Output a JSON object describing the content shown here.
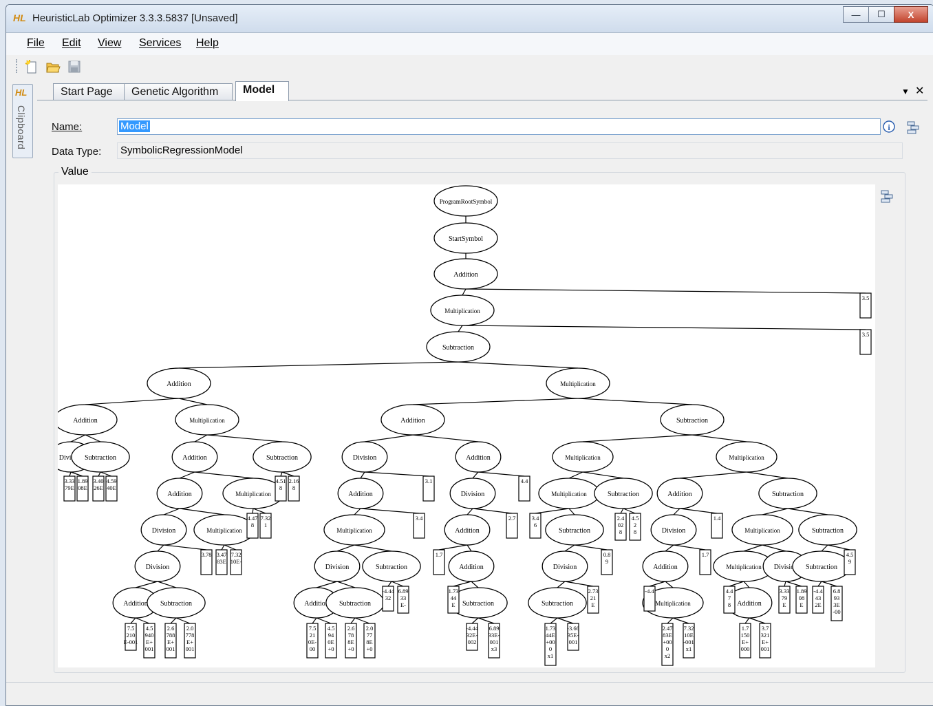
{
  "window": {
    "app_logo": "HL",
    "title": "HeuristicLab Optimizer 3.3.3.5837 [Unsaved]",
    "controls": {
      "minimize": "—",
      "maximize": "☐",
      "close": "X"
    }
  },
  "menu": {
    "items": [
      {
        "label": "File"
      },
      {
        "label": "Edit"
      },
      {
        "label": "View"
      },
      {
        "label": "Services"
      },
      {
        "label": "Help"
      }
    ]
  },
  "toolbar": {
    "icons": [
      "new-file-icon",
      "open-folder-icon",
      "save-icon"
    ]
  },
  "sidebar": {
    "logo": "HL",
    "label": "Clipboard"
  },
  "tabs": [
    {
      "label": "Start Page",
      "active": false
    },
    {
      "label": "Genetic Algorithm",
      "active": false
    },
    {
      "label": "Model",
      "active": true
    }
  ],
  "tab_controls": {
    "dropdown": "▼",
    "close": "✕"
  },
  "form": {
    "name_label": "Name:",
    "name_value": "Model",
    "datatype_label": "Data Type:",
    "datatype_value": "SymbolicRegressionModel",
    "value_label": "Value"
  },
  "tree": {
    "nodes": [
      {
        "id": "root",
        "label": "ProgramRootSymbol"
      },
      {
        "id": "start",
        "label": "StartSymbol",
        "parent": "root"
      },
      {
        "id": "a1",
        "label": "Addition",
        "parent": "start"
      },
      {
        "id": "m1",
        "label": "Multiplication",
        "parent": "a1"
      },
      {
        "id": "s1",
        "label": "Subtraction",
        "parent": "m1"
      },
      {
        "id": "A",
        "label": "Addition",
        "parent": "s1"
      },
      {
        "id": "B",
        "label": "Multiplication",
        "parent": "s1"
      },
      {
        "id": "A1",
        "label": "Addition",
        "parent": "A"
      },
      {
        "id": "A2",
        "label": "Multiplication",
        "parent": "A"
      },
      {
        "id": "A1a",
        "label": "Division",
        "parent": "A1"
      },
      {
        "id": "A1b",
        "label": "Subtraction",
        "parent": "A1"
      },
      {
        "id": "A2a",
        "label": "Addition",
        "parent": "A2"
      },
      {
        "id": "A2b",
        "label": "Subtraction",
        "parent": "A2"
      },
      {
        "id": "A2a1",
        "label": "Addition",
        "parent": "A2a"
      },
      {
        "id": "A2a2",
        "label": "Multiplication",
        "parent": "A2a"
      },
      {
        "id": "A2a1a",
        "label": "Division",
        "parent": "A2a1"
      },
      {
        "id": "A2a1b",
        "label": "Multiplication",
        "parent": "A2a1"
      },
      {
        "id": "A2a1a1",
        "label": "Division",
        "parent": "A2a1a"
      },
      {
        "id": "A2a1a1a",
        "label": "Addition",
        "parent": "A2a1a1"
      },
      {
        "id": "A2a1a1b",
        "label": "Subtraction",
        "parent": "A2a1a1"
      },
      {
        "id": "B1",
        "label": "Addition",
        "parent": "B"
      },
      {
        "id": "B2",
        "label": "Subtraction",
        "parent": "B"
      },
      {
        "id": "B1a",
        "label": "Division",
        "parent": "B1"
      },
      {
        "id": "B1b",
        "label": "Addition",
        "parent": "B1"
      },
      {
        "id": "B1a1",
        "label": "Addition",
        "parent": "B1a"
      },
      {
        "id": "B1a1a",
        "label": "Multiplication",
        "parent": "B1a1"
      },
      {
        "id": "B1a1a1",
        "label": "Division",
        "parent": "B1a1a"
      },
      {
        "id": "B1a1a2",
        "label": "Subtraction",
        "parent": "B1a1a"
      },
      {
        "id": "B1a1a1a",
        "label": "Addition",
        "parent": "B1a1a1"
      },
      {
        "id": "B1a1a1b",
        "label": "Subtraction",
        "parent": "B1a1a1"
      },
      {
        "id": "B1b1",
        "label": "Division",
        "parent": "B1b"
      },
      {
        "id": "B1b1a",
        "label": "Addition",
        "parent": "B1b1"
      },
      {
        "id": "B1b1a1",
        "label": "Addition",
        "parent": "B1b1a"
      },
      {
        "id": "B1b1a1a",
        "label": "Subtraction",
        "parent": "B1b1a1"
      },
      {
        "id": "B2a",
        "label": "Multiplication",
        "parent": "B2"
      },
      {
        "id": "B2b",
        "label": "Multiplication",
        "parent": "B2"
      },
      {
        "id": "B2a1",
        "label": "Multiplication",
        "parent": "B2a"
      },
      {
        "id": "B2a2",
        "label": "Subtraction",
        "parent": "B2a"
      },
      {
        "id": "B2a1a",
        "label": "Subtraction",
        "parent": "B2a1"
      },
      {
        "id": "B2a1a1",
        "label": "Division",
        "parent": "B2a1a"
      },
      {
        "id": "B2a1a1a",
        "label": "Subtraction",
        "parent": "B2a1a1"
      },
      {
        "id": "B2b1",
        "label": "Addition",
        "parent": "B2b"
      },
      {
        "id": "B2b2",
        "label": "Subtraction",
        "parent": "B2b"
      },
      {
        "id": "B2b1a",
        "label": "Division",
        "parent": "B2b1"
      },
      {
        "id": "B2b1a1",
        "label": "Addition",
        "parent": "B2b1a"
      },
      {
        "id": "B2b1a1a",
        "label": "Multiplication",
        "parent": "B2b1a1"
      },
      {
        "id": "B2b2a",
        "label": "Multiplication",
        "parent": "B2b2"
      },
      {
        "id": "B2b2b",
        "label": "Subtraction",
        "parent": "B2b2"
      },
      {
        "id": "B2b2a1",
        "label": "Multiplication",
        "parent": "B2b2a"
      },
      {
        "id": "B2b2a2",
        "label": "Division",
        "parent": "B2b2a"
      },
      {
        "id": "B2b2b1",
        "label": "Subtraction",
        "parent": "B2b2b"
      },
      {
        "id": "B2b2a1a",
        "label": "Addition",
        "parent": "B2b2a1"
      }
    ],
    "leaves": [
      {
        "text": "3.33 79E",
        "parent": "A1a"
      },
      {
        "text": "1.89 08E",
        "parent": "A1a"
      },
      {
        "text": "3.40 26E",
        "parent": "A1b"
      },
      {
        "text": "4.59 40E",
        "parent": "A1b"
      },
      {
        "text": "4.51 8",
        "parent": "A2b"
      },
      {
        "text": "2.16 8",
        "parent": "A2b"
      },
      {
        "text": "4.47 8",
        "parent": "A2a2"
      },
      {
        "text": "7.32 1",
        "parent": "A2a2"
      },
      {
        "text": "3.47 83E",
        "parent": "A2a1b"
      },
      {
        "text": "7.32 10E-",
        "parent": "A2a1b"
      },
      {
        "text": "3.78",
        "parent": "A2a1a"
      },
      {
        "text": "7.5 210 E-001",
        "parent": "A2a1a1a"
      },
      {
        "text": "4.5 940 E+ 001",
        "parent": "A2a1a1a"
      },
      {
        "text": "2.6 788 E+ 001",
        "parent": "A2a1a1b"
      },
      {
        "text": "2.0 778 E+ 001",
        "parent": "A2a1a1b"
      },
      {
        "text": "3.1",
        "parent": "B1a"
      },
      {
        "text": "3.4",
        "parent": "B1a1"
      },
      {
        "text": "-4.44 32",
        "parent": "B1a1a2"
      },
      {
        "text": "6.89 33 E-",
        "parent": "B1a1a2"
      },
      {
        "text": "7.5 21 0E- 00",
        "parent": "B1a1a1a"
      },
      {
        "text": "4.5 94 0E +0",
        "parent": "B1a1a1a"
      },
      {
        "text": "2.6 78 8E +0",
        "parent": "B1a1a1b"
      },
      {
        "text": "2.0 77 8E +0",
        "parent": "B1a1a1b"
      },
      {
        "text": "4.4",
        "parent": "B1b"
      },
      {
        "text": "2.7",
        "parent": "B1b1"
      },
      {
        "text": "1.7",
        "parent": "B1b1a"
      },
      {
        "text": "1.73 44 E",
        "parent": "B1b1a1"
      },
      {
        "text": "-4.44 32E- 002",
        "parent": "B1b1a1a"
      },
      {
        "text": "6.89 33E- 001 x3",
        "parent": "B1b1a1a"
      },
      {
        "text": "2.4 02 8",
        "parent": "B2a2"
      },
      {
        "text": "4.5 2 8",
        "parent": "B2a2"
      },
      {
        "text": "3.4 6",
        "parent": "B2a1"
      },
      {
        "text": "0.8 9",
        "parent": "B2a1a"
      },
      {
        "text": "2.73 21 E",
        "parent": "B2a1a1"
      },
      {
        "text": "1.73 44E +00 0 x1",
        "parent": "B2a1a1a"
      },
      {
        "text": "-3.66 35E- 001",
        "parent": "B2a1a1a"
      },
      {
        "text": "1.4",
        "parent": "B2b1"
      },
      {
        "text": "1.7",
        "parent": "B2b1a"
      },
      {
        "text": "-4.4",
        "parent": "B2b1a1"
      },
      {
        "text": "2.47 83E +00 0 x2",
        "parent": "B2b1a1a"
      },
      {
        "text": "7.32 10E -001 x1",
        "parent": "B2b1a1a"
      },
      {
        "text": "4.4 7 8",
        "parent": "B2b2a1"
      },
      {
        "text": "1.7 150 E+ 000",
        "parent": "B2b2a1a"
      },
      {
        "text": "3.7 321 E+ 001",
        "parent": "B2b2a1a"
      },
      {
        "text": "3.33 79 E",
        "parent": "B2b2a2"
      },
      {
        "text": "1.89 08 E",
        "parent": "B2b2a2"
      },
      {
        "text": "-4.4 43 2E",
        "parent": "B2b2b1"
      },
      {
        "text": "6.8 93 3E -00",
        "parent": "B2b2b1"
      },
      {
        "text": "4.5 9",
        "parent": "B2b2b"
      },
      {
        "text": "3.5",
        "parent": "a1"
      },
      {
        "text": "3.5",
        "parent": "m1"
      }
    ]
  }
}
